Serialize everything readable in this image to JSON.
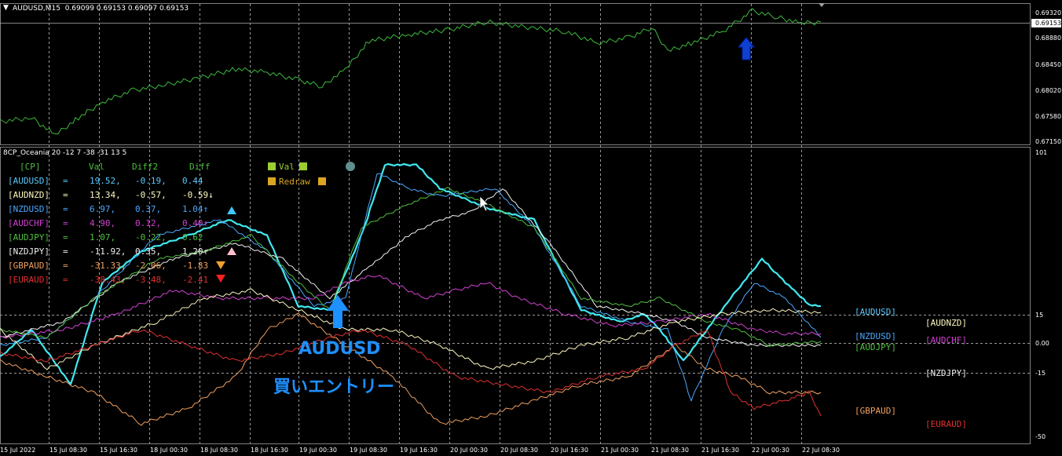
{
  "chart_header": {
    "symbol_info": "AUDUSD,M15  0.69099 0.69153 0.69097 0.69153"
  },
  "indicator_header": {
    "title": "8CP_Oceania 20 -12 7 -38 -31 13 5"
  },
  "price_axis": {
    "ticks": [
      "0.69320",
      "0.68880",
      "0.68450",
      "0.68020",
      "0.67580",
      "0.67150"
    ],
    "current": "0.69153"
  },
  "indicator_axis": {
    "ticks": [
      "101",
      "15",
      "0.00",
      "-15",
      "-50"
    ]
  },
  "time_axis": [
    "15 Jul 2022",
    "15 Jul 08:30",
    "15 Jul 16:30",
    "18 Jul 00:30",
    "18 Jul 08:30",
    "18 Jul 16:30",
    "19 Jul 00:30",
    "19 Jul 08:30",
    "19 Jul 16:30",
    "20 Jul 00:30",
    "20 Jul 08:30",
    "20 Jul 16:30",
    "21 Jul 00:30",
    "21 Jul 08:30",
    "21 Jul 16:30",
    "22 Jul 00:30",
    "22 Jul 08:30"
  ],
  "table": {
    "header": {
      "cp": "[CP]",
      "val": "Val",
      "diff2": "Diff2",
      "diff": "Diff"
    },
    "rows": [
      {
        "pair": "[AUDUSD]",
        "val": "19.52,",
        "diff2": "-0.19,",
        "diff": "0.44",
        "arrow": "",
        "color": "#5bc8ff"
      },
      {
        "pair": "[AUDNZD]",
        "val": "13.34,",
        "diff2": "-0.57,",
        "diff": "-0.59",
        "arrow": "↓",
        "color": "#fff8c0"
      },
      {
        "pair": "[NZDUSD]",
        "val": "6.97,",
        "diff2": "0.37,",
        "diff": "1.04",
        "arrow": "↑",
        "color": "#4aa8ff"
      },
      {
        "pair": "[AUDCHF]",
        "val": "4.90,",
        "diff2": "0.12,",
        "diff": "0.40",
        "arrow": "↑",
        "color": "#d040d0"
      },
      {
        "pair": "[AUDJPY]",
        "val": "1.07,",
        "diff2": "-0.22,",
        "diff": "0.62",
        "arrow": "",
        "color": "#50c040"
      },
      {
        "pair": "[NZDJPY]",
        "val": "-11.92,",
        "diff2": "0.35,",
        "diff": "1.20",
        "arrow": "↑",
        "color": "#f0f0f0"
      },
      {
        "pair": "[GBPAUD]",
        "val": "-31.33,",
        "diff2": "-2.06,",
        "diff": "-1.83",
        "arrow": "",
        "color": "#f0a060"
      },
      {
        "pair": "[EURAUD]",
        "val": "-38.43,",
        "diff2": "-3.48,",
        "diff": "-2.41",
        "arrow": "",
        "color": "#e03030"
      }
    ]
  },
  "buttons": {
    "val": "Val",
    "redraw": "Redraw"
  },
  "right_labels": [
    "[AUDUSD]",
    "[AUDNZD]",
    "[NZDUSD]",
    "[AUDCHF]",
    "[AUDJPY]",
    "[NZDJPY]",
    "[GBPAUD]",
    "[EURAUD]"
  ],
  "annotation": {
    "line1": "AUDUSD",
    "line2": "買いエントリー"
  },
  "colors": {
    "price_line": "#3cb83c",
    "AUDUSD": "#40e8f0",
    "NZDUSD": "#4aa8ff",
    "AUDNZD": "#fff8c0",
    "AUDCHF": "#d040d0",
    "AUDJPY": "#50c040",
    "NZDJPY": "#f0f0f0",
    "GBPAUD": "#f0a060",
    "EURAUD": "#e03030",
    "annotation": "#1e90ff"
  }
}
